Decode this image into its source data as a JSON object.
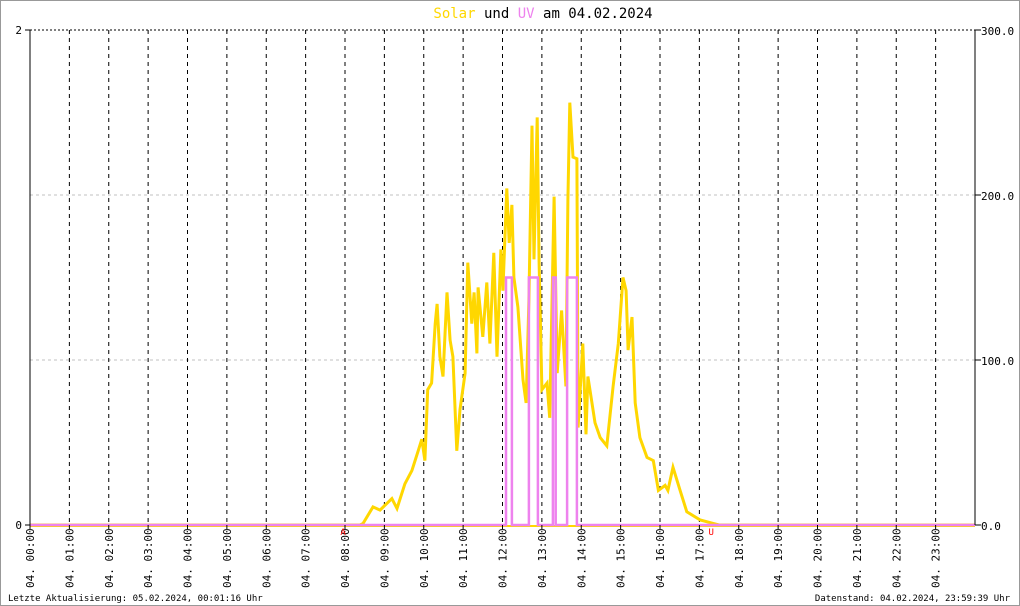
{
  "chart_data": {
    "type": "line",
    "title_parts": {
      "solar": "Solar",
      "und": "und",
      "uv": "UV",
      "rest": "am 04.02.2024"
    },
    "colors": {
      "solar": "#ffd700",
      "uv": "#ee82ee",
      "marker": "#ff0000"
    },
    "left_axis": {
      "label_max": "2",
      "label_min": "0",
      "ylim": [
        0,
        2
      ]
    },
    "right_axis": {
      "ticks": [
        "0.0",
        "100.0",
        "200.0",
        "300.0"
      ],
      "ylim": [
        0,
        300
      ]
    },
    "x_range_hours": [
      0,
      24
    ],
    "x_tick_labels": [
      "04. 00:00",
      "04. 01:00",
      "04. 02:00",
      "04. 03:00",
      "04. 04:00",
      "04. 05:00",
      "04. 06:00",
      "04. 07:00",
      "04. 08:00",
      "04. 09:00",
      "04. 10:00",
      "04. 11:00",
      "04. 12:00",
      "04. 13:00",
      "04. 14:00",
      "04. 15:00",
      "04. 16:00",
      "04. 17:00",
      "04. 18:00",
      "04. 19:00",
      "04. 20:00",
      "04. 21:00",
      "04. 22:00",
      "04. 23:00"
    ],
    "markers": [
      {
        "label": "A",
        "hour": 7.95
      },
      {
        "label": "U",
        "hour": 17.3
      }
    ],
    "series": [
      {
        "name": "Solar",
        "axis": "right",
        "points": [
          [
            0,
            0
          ],
          [
            8.38,
            0
          ],
          [
            8.46,
            1
          ],
          [
            8.71,
            11
          ],
          [
            8.89,
            9
          ],
          [
            9.19,
            16
          ],
          [
            9.32,
            10
          ],
          [
            9.52,
            25
          ],
          [
            9.7,
            33
          ],
          [
            9.86,
            45
          ],
          [
            9.95,
            52
          ],
          [
            10.03,
            39
          ],
          [
            10.1,
            82
          ],
          [
            10.2,
            86
          ],
          [
            10.29,
            122
          ],
          [
            10.34,
            134
          ],
          [
            10.41,
            102
          ],
          [
            10.49,
            90
          ],
          [
            10.59,
            141
          ],
          [
            10.67,
            112
          ],
          [
            10.74,
            102
          ],
          [
            10.84,
            45
          ],
          [
            10.92,
            70
          ],
          [
            11.05,
            92
          ],
          [
            11.12,
            159
          ],
          [
            11.22,
            122
          ],
          [
            11.28,
            141
          ],
          [
            11.35,
            104
          ],
          [
            11.38,
            144
          ],
          [
            11.5,
            114
          ],
          [
            11.6,
            147
          ],
          [
            11.68,
            110
          ],
          [
            11.78,
            165
          ],
          [
            11.86,
            102
          ],
          [
            11.96,
            167
          ],
          [
            12.01,
            142
          ],
          [
            12.11,
            204
          ],
          [
            12.17,
            171
          ],
          [
            12.24,
            194
          ],
          [
            12.29,
            150
          ],
          [
            12.39,
            132
          ],
          [
            12.52,
            88
          ],
          [
            12.6,
            74
          ],
          [
            12.67,
            136
          ],
          [
            12.75,
            242
          ],
          [
            12.8,
            161
          ],
          [
            12.88,
            247
          ],
          [
            12.93,
            159
          ],
          [
            13.0,
            82
          ],
          [
            13.13,
            86
          ],
          [
            13.2,
            65
          ],
          [
            13.31,
            199
          ],
          [
            13.39,
            92
          ],
          [
            13.5,
            130
          ],
          [
            13.61,
            84
          ],
          [
            13.66,
            197
          ],
          [
            13.71,
            256
          ],
          [
            13.79,
            223
          ],
          [
            13.89,
            222
          ],
          [
            13.92,
            59
          ],
          [
            14.04,
            110
          ],
          [
            14.12,
            55
          ],
          [
            14.17,
            90
          ],
          [
            14.35,
            62
          ],
          [
            14.48,
            53
          ],
          [
            14.65,
            48
          ],
          [
            14.81,
            84
          ],
          [
            14.94,
            110
          ],
          [
            15.06,
            150
          ],
          [
            15.14,
            142
          ],
          [
            15.19,
            106
          ],
          [
            15.29,
            126
          ],
          [
            15.37,
            74
          ],
          [
            15.49,
            53
          ],
          [
            15.67,
            41
          ],
          [
            15.83,
            39
          ],
          [
            15.96,
            21
          ],
          [
            16.13,
            24
          ],
          [
            16.2,
            21
          ],
          [
            16.33,
            35
          ],
          [
            16.51,
            21
          ],
          [
            16.68,
            8
          ],
          [
            17.02,
            3
          ],
          [
            17.35,
            1
          ],
          [
            17.5,
            0
          ],
          [
            24,
            0
          ]
        ]
      },
      {
        "name": "UV",
        "axis": "left",
        "points": [
          [
            0,
            0
          ],
          [
            12.09,
            0
          ],
          [
            12.09,
            1
          ],
          [
            12.24,
            1
          ],
          [
            12.24,
            0
          ],
          [
            12.67,
            0
          ],
          [
            12.67,
            1
          ],
          [
            12.9,
            1
          ],
          [
            12.9,
            0
          ],
          [
            13.28,
            0
          ],
          [
            13.28,
            1
          ],
          [
            13.35,
            1
          ],
          [
            13.35,
            0
          ],
          [
            13.64,
            0
          ],
          [
            13.64,
            1
          ],
          [
            13.89,
            1
          ],
          [
            13.89,
            0
          ],
          [
            24,
            0
          ]
        ]
      }
    ]
  },
  "footer": {
    "last_update": "Letzte Aktualisierung: 05.02.2024, 00:01:16 Uhr",
    "data_state": "Datenstand: 04.02.2024, 23:59:39 Uhr"
  }
}
